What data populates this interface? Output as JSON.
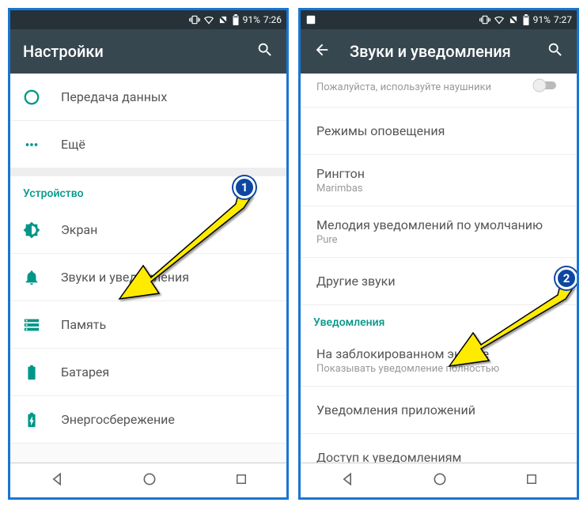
{
  "statusbar": {
    "battery_pct": "91%",
    "time_left": "7:26",
    "time_right": "7:27"
  },
  "left": {
    "title": "Настройки",
    "items": {
      "data_usage": "Передача данных",
      "more": "Ещё",
      "display": "Экран",
      "sound": "Звуки и уведомления",
      "storage": "Память",
      "battery": "Батарея",
      "power_save": "Энергосбережение"
    },
    "section_device": "Устройство"
  },
  "right": {
    "title": "Звуки и уведомления",
    "partial_hint": "Пожалуйста, используйте наушники",
    "items": {
      "alert_modes": "Режимы оповещения",
      "ringtone": "Рингтон",
      "ringtone_value": "Marimbas",
      "notif_sound": "Мелодия уведомлений по умолчанию",
      "notif_sound_value": "Pure",
      "other_sounds": "Другие звуки",
      "on_lock": "На заблокированном экране",
      "on_lock_value": "Показывать уведомление полностью",
      "app_notifications": "Уведомления приложений",
      "notification_access": "Доступ к уведомлениям"
    },
    "section_notifications": "Уведомления"
  },
  "annotations": {
    "badge1": "1",
    "badge2": "2"
  }
}
